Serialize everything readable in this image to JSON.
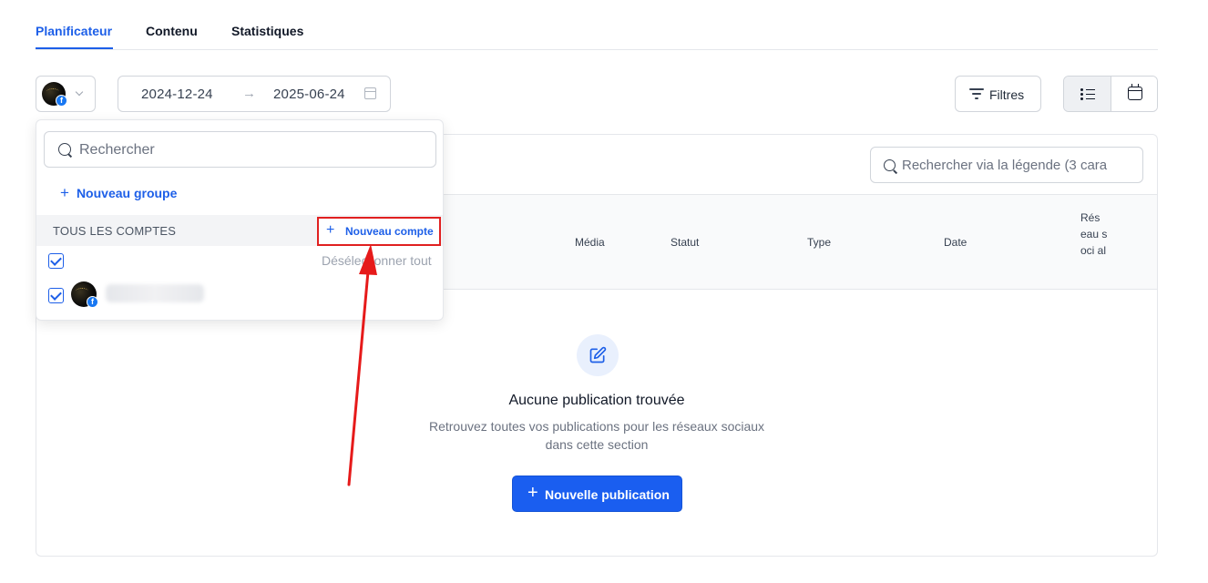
{
  "tabs": [
    "Planificateur",
    "Contenu",
    "Statistiques"
  ],
  "date_range": {
    "start": "2024-12-24",
    "end": "2025-06-24"
  },
  "filters_label": "Filtres",
  "caption_search_placeholder": "Rechercher via la légende (3 cara",
  "table_headers": {
    "media": "Média",
    "status": "Statut",
    "type": "Type",
    "date": "Date",
    "network": "Rés eau soci al"
  },
  "empty_state": {
    "title": "Aucune publication trouvée",
    "description": "Retrouvez toutes vos publications pour les réseaux sociaux dans cette section",
    "button": "Nouvelle publication"
  },
  "dropdown": {
    "search_placeholder": "Rechercher",
    "new_group": "Nouveau groupe",
    "all_accounts": "TOUS LES COMPTES",
    "new_account": "Nouveau compte",
    "deselect_all": "Désélectionner tout"
  },
  "icons": [
    "facebook-icon",
    "chevron-down-icon",
    "arrow-right-icon",
    "calendar-icon",
    "filter-icon",
    "list-icon",
    "search-icon",
    "edit-icon",
    "plus-icon",
    "check-icon"
  ],
  "colors": {
    "accent": "#1d5fe8",
    "primary_button": "#1a5ef0",
    "annotation": "#e02020"
  }
}
